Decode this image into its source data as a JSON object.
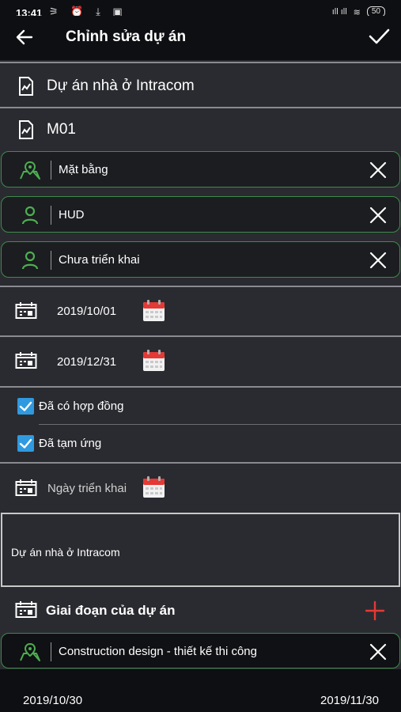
{
  "status_bar": {
    "time": "13:41",
    "left_icons": "⚞ ⏰ ⤓ ▣",
    "signal": "ıll ıll",
    "wifi": "≋",
    "battery": "50"
  },
  "app_bar": {
    "title": "Chỉnh sửa dự án"
  },
  "project_name": "Dự án nhà ở Intracom",
  "project_code": "M01",
  "pills": [
    {
      "label": "Mặt bằng",
      "icon": "map-pin-icon"
    },
    {
      "label": "HUD",
      "icon": "person-icon"
    },
    {
      "label": "Chưa triển khai",
      "icon": "person-icon"
    }
  ],
  "dates": {
    "start": "2019/10/01",
    "end": "2019/12/31",
    "deploy_placeholder": "Ngày triển khai"
  },
  "checkboxes": [
    {
      "label": "Đã có hợp đồng",
      "checked": true
    },
    {
      "label": "Đã tạm ứng",
      "checked": true
    }
  ],
  "description": "Dự án nhà ở Intracom",
  "phases": {
    "title": "Giai đoạn của dự án",
    "items": [
      {
        "label": "Construction design - thiết kế thi công",
        "start": "2019/10/30",
        "end": "2019/11/30"
      }
    ]
  },
  "colors": {
    "background": "#2a2b30",
    "bar": "#0e0f12",
    "green_accent": "#3e8b4a",
    "checkbox_blue": "#2f9ae0",
    "add_red": "#e53935"
  }
}
